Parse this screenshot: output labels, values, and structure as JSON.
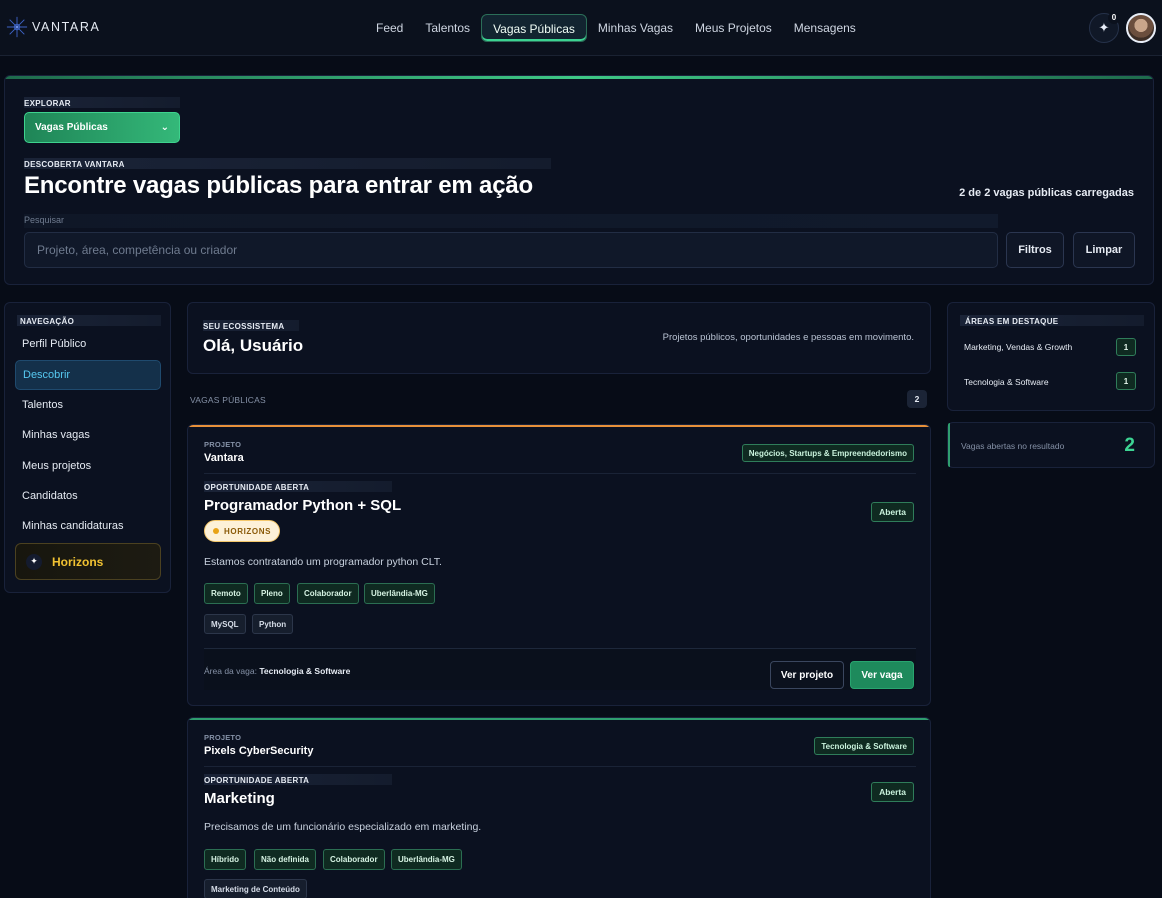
{
  "app": {
    "brand": "VANTARA"
  },
  "nav": {
    "items": [
      "Feed",
      "Talentos",
      "Vagas Públicas",
      "Minhas Vagas",
      "Meus Projetos",
      "Mensagens"
    ],
    "active": "Vagas Públicas"
  },
  "header": {
    "spark_count": "0",
    "spark_icon": "sparkle-icon",
    "avatar": "user-avatar"
  },
  "hero": {
    "explore_label": "EXPLORAR",
    "explore_selected": "Vagas Públicas",
    "discovery_label": "DESCOBERTA VANTARA",
    "title": "Encontre vagas públicas para entrar em ação",
    "count_text": "2 de 2 vagas públicas carregadas",
    "search_label": "Pesquisar",
    "search_placeholder": "Projeto, área, competência ou criador",
    "filters_label": "Filtros",
    "clear_label": "Limpar"
  },
  "sidebar": {
    "heading": "NAVEGAÇÃO",
    "items": [
      "Perfil Público",
      "Descobrir",
      "Talentos",
      "Minhas vagas",
      "Meus projetos",
      "Candidatos",
      "Minhas candidaturas"
    ],
    "active": "Descobrir",
    "horizons_label": "Horizons"
  },
  "greeting": {
    "label": "SEU ECOSSISTEMA",
    "title": "Olá, Usuário",
    "description": "Projetos públicos, oportunidades e pessoas em movimento."
  },
  "jobs_section": {
    "label": "VAGAS PÚBLICAS",
    "count": "2"
  },
  "jobs": [
    {
      "project_label": "PROJETO",
      "project_name": "Vantara",
      "category": "Negócios, Startups & Empreendedorismo",
      "opportunity_label": "OPORTUNIDADE ABERTA",
      "title": "Programador Python + SQL",
      "status": "Aberta",
      "badge": "HORIZONS",
      "description": "Estamos contratando um programador python CLT.",
      "tags": [
        "Remoto",
        "Pleno",
        "Colaborador",
        "Uberlândia-MG"
      ],
      "skills": [
        "MySQL",
        "Python"
      ],
      "area_label": "Área da vaga:",
      "area_value": "Tecnologia & Software",
      "btn_project": "Ver projeto",
      "btn_job": "Ver vaga",
      "accent": "#e8913a"
    },
    {
      "project_label": "PROJETO",
      "project_name": "Pixels CyberSecurity",
      "category": "Tecnologia & Software",
      "opportunity_label": "OPORTUNIDADE ABERTA",
      "title": "Marketing",
      "status": "Aberta",
      "description": "Precisamos de um funcionário especializado em marketing.",
      "tags": [
        "Híbrido",
        "Não definida",
        "Colaborador",
        "Uberlândia-MG"
      ],
      "skills": [
        "Marketing de Conteúdo"
      ],
      "accent": "#2f9e6f"
    }
  ],
  "featured_areas": {
    "heading": "ÁREAS EM DESTAQUE",
    "items": [
      {
        "name": "Marketing, Vendas & Growth",
        "count": "1"
      },
      {
        "name": "Tecnologia & Software",
        "count": "1"
      }
    ]
  },
  "stats": {
    "label": "Vagas abertas no resultado",
    "value": "2"
  },
  "colors": {
    "accent_green": "#34b879",
    "accent_orange": "#e8913a",
    "bg": "#070c17",
    "active_blue": "#56c8f0"
  }
}
